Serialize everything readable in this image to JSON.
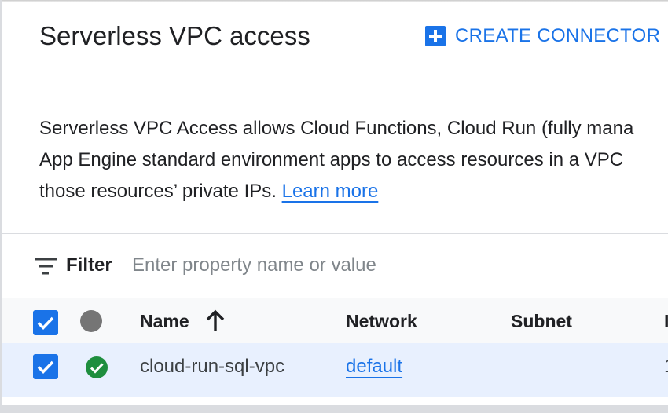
{
  "header": {
    "title": "Serverless VPC access",
    "create_button_label": "CREATE CONNECTOR",
    "create_icon": "add-box-icon"
  },
  "description": {
    "line1": "Serverless VPC Access allows Cloud Functions, Cloud Run (fully mana",
    "line2": "App Engine standard environment apps to access resources in a VPC",
    "line3": "those resources’ private IPs.",
    "learn_more": "Learn more"
  },
  "filter": {
    "label": "Filter",
    "placeholder": "Enter property name or value",
    "icon": "filter-list-icon"
  },
  "table": {
    "columns": [
      {
        "label": "Name",
        "sort": "ascending",
        "sort_icon": "arrow-upward-icon"
      },
      {
        "label": "Network"
      },
      {
        "label": "Subnet"
      },
      {
        "label": "I"
      }
    ],
    "rows": [
      {
        "selected": true,
        "status": "ok",
        "status_icon": "check-circle-icon",
        "name": "cloud-run-sql-vpc",
        "network": "default",
        "subnet": "",
        "extra": "1"
      }
    ]
  },
  "colors": {
    "accent": "#1a73e8",
    "status_ok": "#1e8e3e",
    "selected_row_bg": "#e8f0fe"
  }
}
